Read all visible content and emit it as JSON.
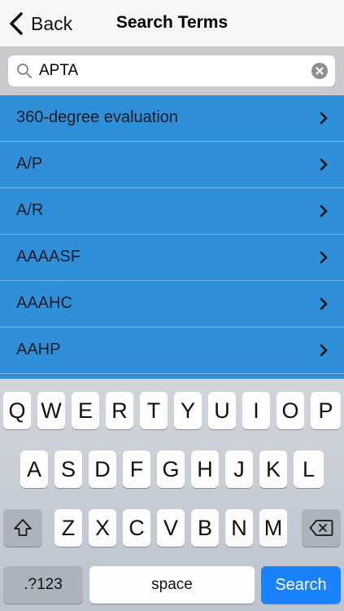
{
  "nav": {
    "back_label": "Back",
    "title": "Search Terms"
  },
  "search": {
    "value": "APTA"
  },
  "results": [
    {
      "label": "360-degree evaluation"
    },
    {
      "label": "A/P"
    },
    {
      "label": "A/R"
    },
    {
      "label": "AAAASF"
    },
    {
      "label": "AAAHC"
    },
    {
      "label": "AAHP"
    }
  ],
  "keyboard": {
    "row1": [
      "Q",
      "W",
      "E",
      "R",
      "T",
      "Y",
      "U",
      "I",
      "O",
      "P"
    ],
    "row2": [
      "A",
      "S",
      "D",
      "F",
      "G",
      "H",
      "J",
      "K",
      "L"
    ],
    "row3": [
      "Z",
      "X",
      "C",
      "V",
      "B",
      "N",
      "M"
    ],
    "numbers_label": ".?123",
    "space_label": "space",
    "search_label": "Search"
  },
  "colors": {
    "list_background": "#2f8fd8",
    "search_key": "#1a82fb",
    "keyboard": "#c6ccd4"
  },
  "icons": {
    "back": "chevron-left-icon",
    "search": "magnifier-icon",
    "clear": "clear-circle-icon",
    "shift": "shift-arrow-icon",
    "delete": "backspace-icon",
    "row": "chevron-right-icon"
  }
}
